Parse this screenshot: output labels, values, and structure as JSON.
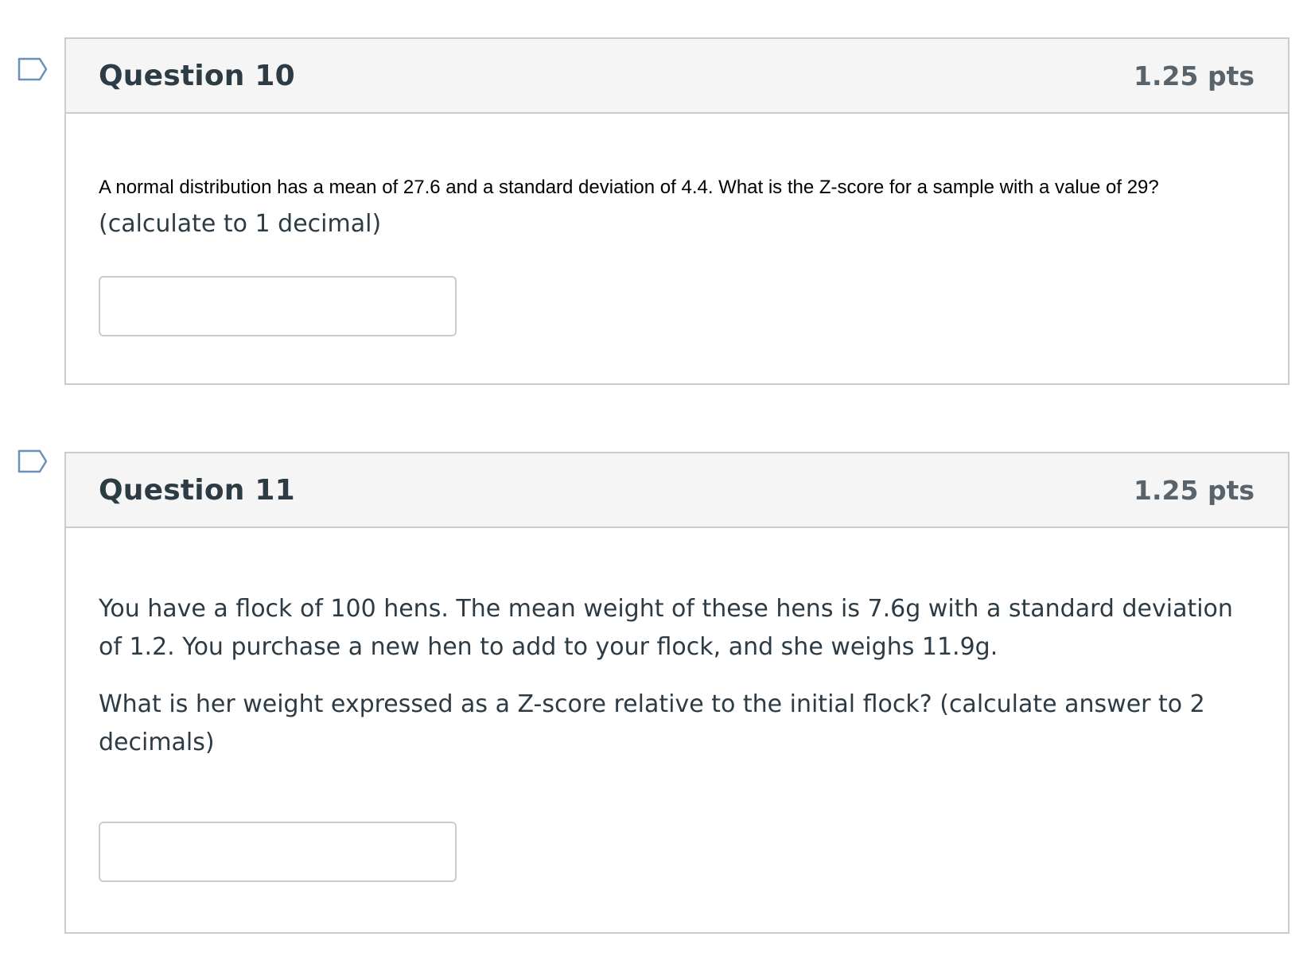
{
  "colors": {
    "flag_stroke": "#6b90b8",
    "header_bg": "#f5f5f5",
    "border": "#c7cdd1",
    "title": "#2d3b45",
    "points": "#58636b"
  },
  "questions": [
    {
      "flag_icon": "bookmark-flag-icon",
      "title": "Question 10",
      "points": "1.25 pts",
      "text_main": "A normal distribution has a mean of 27.6 and a standard deviation of 4.4. What is the Z-score for a sample with a value of 29?",
      "text_suffix": "(calculate to 1 decimal)",
      "answer_value": ""
    },
    {
      "flag_icon": "bookmark-flag-icon",
      "title": "Question 11",
      "points": "1.25 pts",
      "paragraph_1": "You have a flock of 100 hens. The mean weight of these hens is 7.6g with a standard deviation of 1.2. You purchase a new hen to add to your flock, and she weighs 11.9g.",
      "paragraph_2": "What is her weight expressed as a Z-score relative to the initial flock? (calculate answer to 2 decimals)",
      "answer_value": ""
    }
  ]
}
